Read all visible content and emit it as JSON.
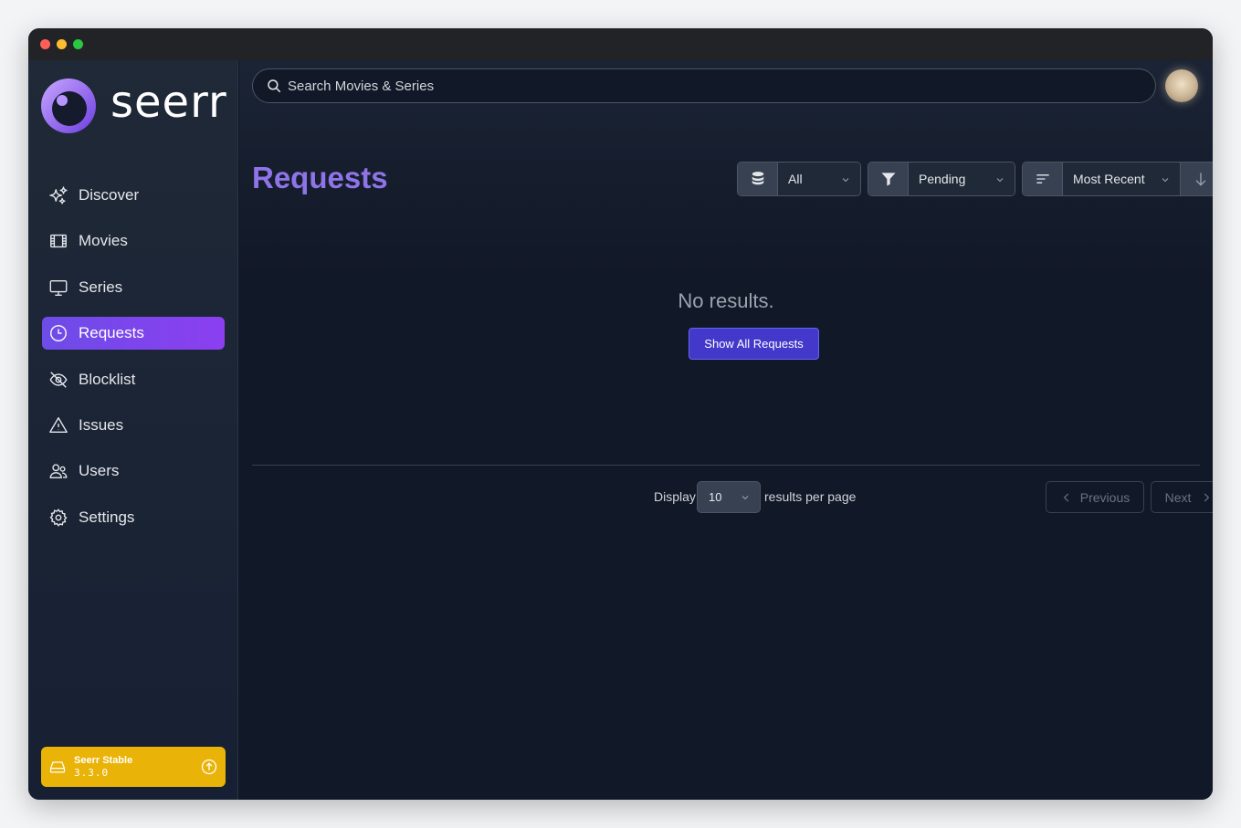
{
  "app": {
    "logo_text": "seerr",
    "brand_color": "#8f74e8",
    "accent_color": "#7c45ee"
  },
  "search": {
    "placeholder": "Search Movies & Series"
  },
  "sidebar": {
    "items": [
      {
        "label": "Discover",
        "icon": "sparkles-icon",
        "active": false
      },
      {
        "label": "Movies",
        "icon": "film-icon",
        "active": false
      },
      {
        "label": "Series",
        "icon": "tv-icon",
        "active": false
      },
      {
        "label": "Requests",
        "icon": "clock-icon",
        "active": true
      },
      {
        "label": "Blocklist",
        "icon": "eye-slash-icon",
        "active": false
      },
      {
        "label": "Issues",
        "icon": "warning-icon",
        "active": false
      },
      {
        "label": "Users",
        "icon": "users-icon",
        "active": false
      },
      {
        "label": "Settings",
        "icon": "gear-icon",
        "active": false
      }
    ],
    "version": {
      "name": "Seerr Stable",
      "number": "3.3.0",
      "color": "#eab308"
    }
  },
  "main": {
    "title": "Requests",
    "filters": {
      "media_type": "All",
      "status": "Pending",
      "sort": "Most Recent"
    },
    "empty_message": "No results.",
    "show_all_label": "Show All Requests",
    "pagination": {
      "display_label": "Display",
      "per_page": "10",
      "results_label": "results per page",
      "previous_label": "Previous",
      "next_label": "Next"
    }
  }
}
